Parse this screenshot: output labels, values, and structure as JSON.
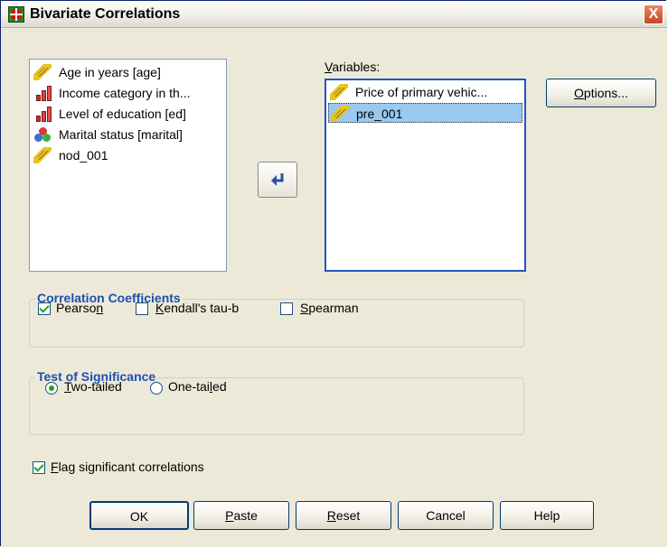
{
  "window": {
    "title": "Bivariate Correlations",
    "close_label": "X",
    "accent_color": "#2552c8"
  },
  "source_list": {
    "items": [
      {
        "label": "Age in years [age]",
        "icon": "scale-ruler-icon"
      },
      {
        "label": "Income category in th...",
        "icon": "ordinal-bars-icon"
      },
      {
        "label": "Level of education [ed]",
        "icon": "ordinal-bars-icon"
      },
      {
        "label": "Marital status [marital]",
        "icon": "nominal-circles-icon"
      },
      {
        "label": "nod_001",
        "icon": "scale-ruler-icon"
      }
    ]
  },
  "target_list": {
    "label_underlined": "V",
    "label_rest": "ariables:",
    "items": [
      {
        "label": "Price of primary vehic...",
        "icon": "scale-ruler-icon"
      },
      {
        "label": "pre_001",
        "icon": "scale-ruler-icon",
        "selected": true
      }
    ]
  },
  "move_button": {
    "icon": "move-arrow-icon"
  },
  "options_button": {
    "label_underlined": "O",
    "label_rest": "ptions..."
  },
  "correlation_coefficients": {
    "title": "Correlation Coefficients",
    "pearson": {
      "label_pre": "Pearso",
      "label_u": "n",
      "label_post": "",
      "checked": true
    },
    "kendall": {
      "label_pre": "",
      "label_u": "K",
      "label_post": "endall's tau-b",
      "checked": false
    },
    "spearman": {
      "label_pre": "",
      "label_u": "S",
      "label_post": "pearman",
      "checked": false
    }
  },
  "test_of_significance": {
    "title": "Test of Significance",
    "two_tailed": {
      "label_u": "T",
      "label_post": "wo-tailed",
      "checked": true
    },
    "one_tailed": {
      "label_pre": "One-tai",
      "label_u": "l",
      "label_post": "ed",
      "checked": false
    }
  },
  "flag": {
    "label_u": "F",
    "label_post": "lag significant correlations",
    "checked": true
  },
  "buttons": {
    "ok": "OK",
    "paste_u": "P",
    "paste_rest": "aste",
    "reset_u": "R",
    "reset_rest": "eset",
    "cancel": "Cancel",
    "help": "Help"
  }
}
